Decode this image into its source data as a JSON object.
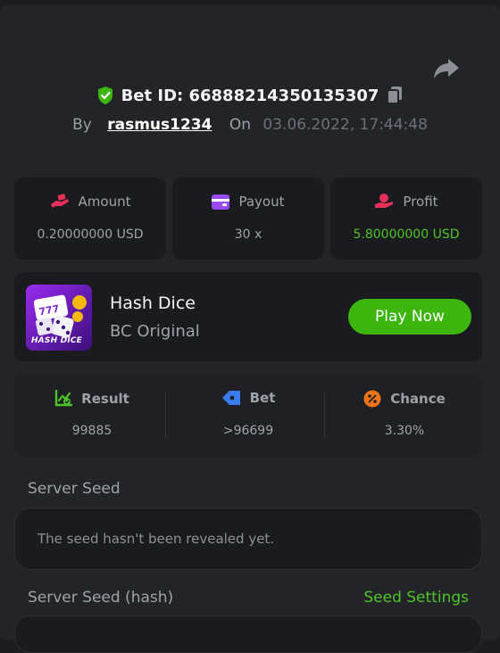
{
  "bet": {
    "id_label": "Bet ID: 66888214350135307",
    "by_label": "By",
    "username": "rasmus1234",
    "on_label": "On",
    "datetime": "03.06.2022, 17:44:48"
  },
  "stats": [
    {
      "label": "Amount",
      "value": "0.20000000 USD",
      "icon": "bet-hand-icon",
      "icon_color": "#e9305b"
    },
    {
      "label": "Payout",
      "value": "30 x",
      "icon": "wallet-icon",
      "icon_color": "#9b4bf5"
    },
    {
      "label": "Profit",
      "value": "5.80000000 USD",
      "icon": "coin-hand-icon",
      "icon_color": "#e9305b"
    }
  ],
  "game": {
    "title": "Hash Dice",
    "subtitle": "BC Original",
    "thumb_label": "HASH DICE",
    "play_label": "Play Now"
  },
  "result": [
    {
      "label": "Result",
      "value": "99885",
      "icon": "chart-check-icon",
      "icon_color": "#4ec42a"
    },
    {
      "label": "Bet",
      "value": ">96699",
      "icon": "ticket-icon",
      "icon_color": "#3a7bf0"
    },
    {
      "label": "Chance",
      "value": "3.30%",
      "icon": "percent-icon",
      "icon_color": "#f07419"
    }
  ],
  "seeds": {
    "server_seed_label": "Server Seed",
    "server_seed_text": "The seed hasn't been revealed yet.",
    "server_hash_label": "Server Seed (hash)",
    "seed_settings_label": "Seed Settings"
  },
  "colors": {
    "accent_green": "#3cb60f",
    "profit_green": "#4ec42a",
    "panel": "#232428",
    "card": "#1a1b1e"
  }
}
